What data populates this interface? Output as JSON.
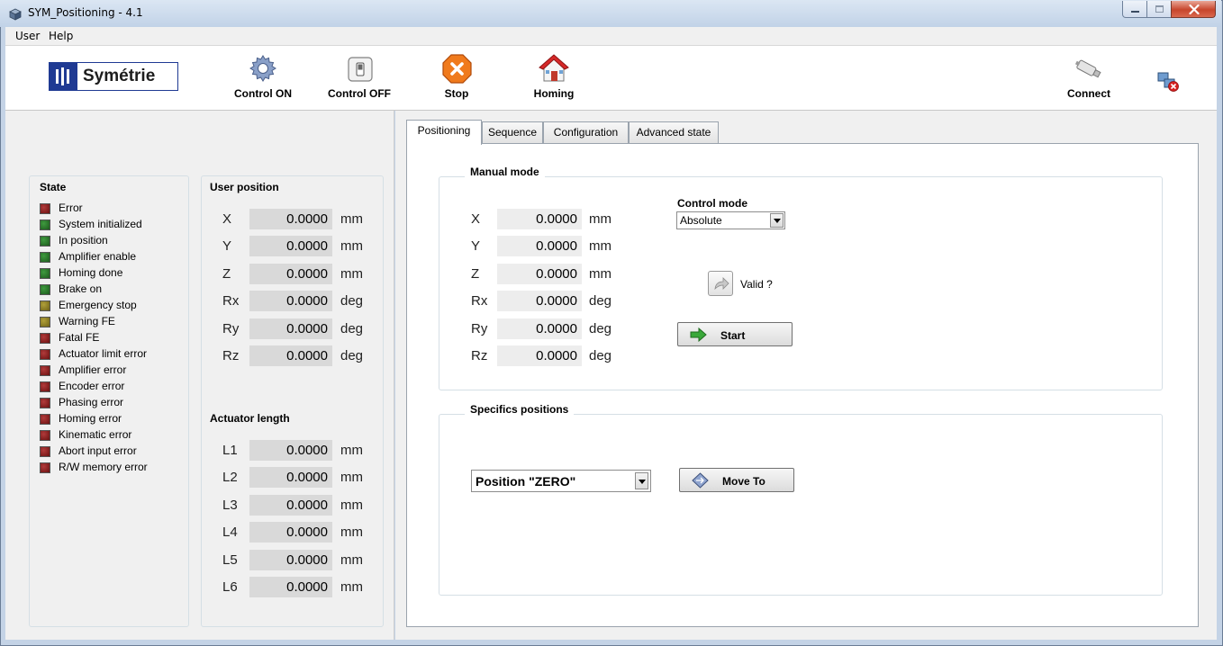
{
  "window": {
    "title": "SYM_Positioning - 4.1"
  },
  "menu": {
    "items": [
      "User",
      "Help"
    ]
  },
  "toolbar": {
    "logo_text": "Symétrie",
    "control_on": "Control ON",
    "control_off": "Control OFF",
    "stop": "Stop",
    "homing": "Homing",
    "connect": "Connect"
  },
  "state": {
    "title": "State",
    "items": [
      {
        "label": "Error",
        "color": "red"
      },
      {
        "label": "System initialized",
        "color": "green"
      },
      {
        "label": "In position",
        "color": "green"
      },
      {
        "label": "Amplifier enable",
        "color": "green"
      },
      {
        "label": "Homing done",
        "color": "green"
      },
      {
        "label": "Brake on",
        "color": "green"
      },
      {
        "label": "Emergency stop",
        "color": "yellow"
      },
      {
        "label": "Warning FE",
        "color": "yellow"
      },
      {
        "label": "Fatal FE",
        "color": "red"
      },
      {
        "label": "Actuator limit error",
        "color": "red"
      },
      {
        "label": "Amplifier error",
        "color": "red"
      },
      {
        "label": "Encoder error",
        "color": "red"
      },
      {
        "label": "Phasing error",
        "color": "red"
      },
      {
        "label": "Homing error",
        "color": "red"
      },
      {
        "label": "Kinematic error",
        "color": "red"
      },
      {
        "label": "Abort input error",
        "color": "red"
      },
      {
        "label": "R/W memory error",
        "color": "red"
      }
    ]
  },
  "user_position": {
    "title": "User position",
    "rows": [
      {
        "axis": "X",
        "value": "0.0000",
        "unit": "mm"
      },
      {
        "axis": "Y",
        "value": "0.0000",
        "unit": "mm"
      },
      {
        "axis": "Z",
        "value": "0.0000",
        "unit": "mm"
      },
      {
        "axis": "Rx",
        "value": "0.0000",
        "unit": "deg"
      },
      {
        "axis": "Ry",
        "value": "0.0000",
        "unit": "deg"
      },
      {
        "axis": "Rz",
        "value": "0.0000",
        "unit": "deg"
      }
    ]
  },
  "actuator_length": {
    "title": "Actuator length",
    "rows": [
      {
        "axis": "L1",
        "value": "0.0000",
        "unit": "mm"
      },
      {
        "axis": "L2",
        "value": "0.0000",
        "unit": "mm"
      },
      {
        "axis": "L3",
        "value": "0.0000",
        "unit": "mm"
      },
      {
        "axis": "L4",
        "value": "0.0000",
        "unit": "mm"
      },
      {
        "axis": "L5",
        "value": "0.0000",
        "unit": "mm"
      },
      {
        "axis": "L6",
        "value": "0.0000",
        "unit": "mm"
      }
    ]
  },
  "tabs": [
    "Positioning",
    "Sequence",
    "Configuration",
    "Advanced state"
  ],
  "manual_mode": {
    "title": "Manual mode",
    "rows": [
      {
        "axis": "X",
        "value": "0.0000",
        "unit": "mm"
      },
      {
        "axis": "Y",
        "value": "0.0000",
        "unit": "mm"
      },
      {
        "axis": "Z",
        "value": "0.0000",
        "unit": "mm"
      },
      {
        "axis": "Rx",
        "value": "0.0000",
        "unit": "deg"
      },
      {
        "axis": "Ry",
        "value": "0.0000",
        "unit": "deg"
      },
      {
        "axis": "Rz",
        "value": "0.0000",
        "unit": "deg"
      }
    ],
    "control_mode_label": "Control mode",
    "control_mode_value": "Absolute",
    "valid_label": "Valid ?",
    "start_label": "Start"
  },
  "specifics": {
    "title": "Specifics positions",
    "position_value": "Position \"ZERO\"",
    "move_to_label": "Move To"
  },
  "colors": {
    "led_red": "#8b1a1a",
    "led_green": "#2f7a2f",
    "led_yellow": "#8f7f22",
    "logo_blue": "#1f3a93"
  }
}
